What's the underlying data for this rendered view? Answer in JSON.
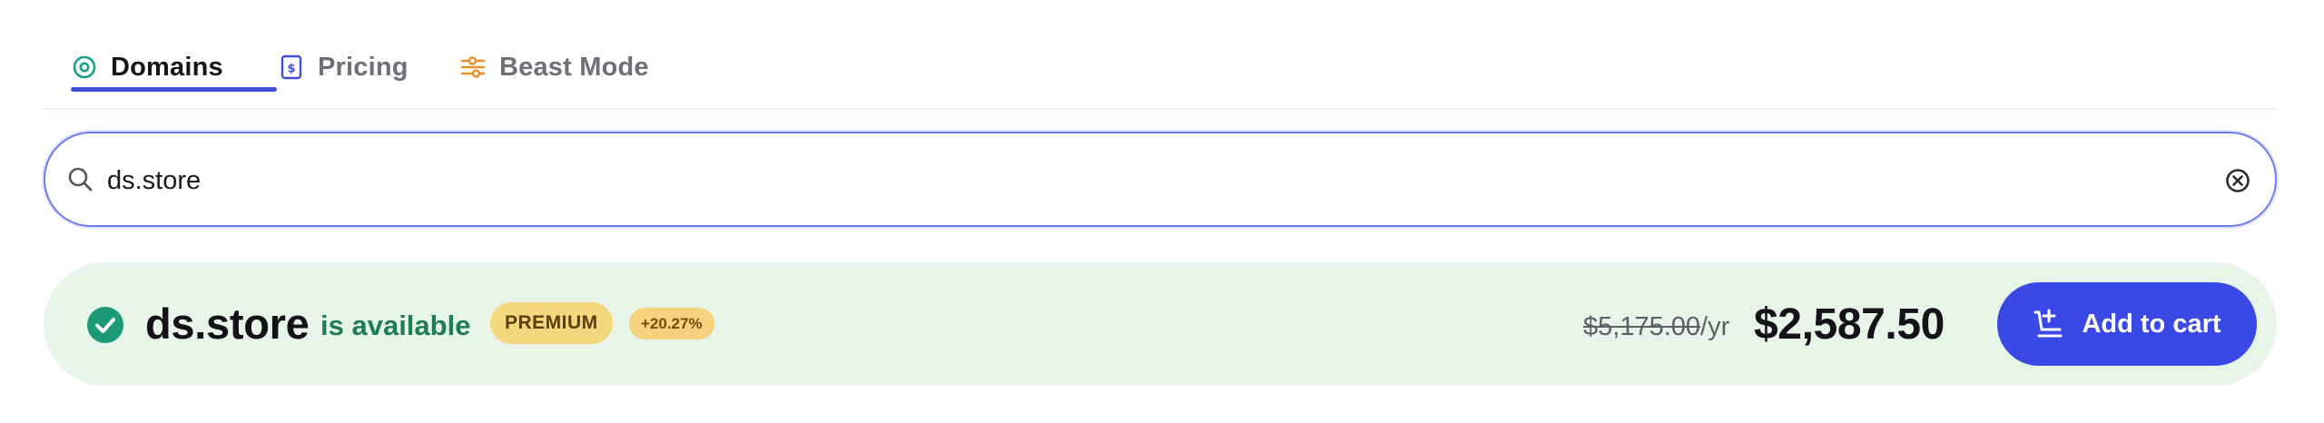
{
  "tabs": [
    {
      "label": "Domains",
      "icon": "target-icon",
      "active": true
    },
    {
      "label": "Pricing",
      "icon": "price-tag-icon",
      "active": false
    },
    {
      "label": "Beast Mode",
      "icon": "sliders-icon",
      "active": false
    }
  ],
  "search": {
    "value": "ds.store",
    "icon": "search-icon",
    "clear_icon": "clear-circle-icon"
  },
  "result": {
    "domain": "ds.store",
    "status": "is available",
    "premium_badge": "PREMIUM",
    "change_badge": "+20.27%",
    "old_price": "$5,175.00",
    "old_price_period": "/yr",
    "price": "$2,587.50",
    "cart_button": "Add to cart"
  },
  "colors": {
    "accent": "#3a48e6",
    "tab_underline": "#3d4ed7",
    "available_green": "#1d7d55",
    "result_background": "#e7f4e8",
    "premium_badge": "#f3d77c",
    "domains_icon": "#1aa08a",
    "pricing_icon": "#3d4ed7",
    "beast_icon": "#e8912a"
  }
}
